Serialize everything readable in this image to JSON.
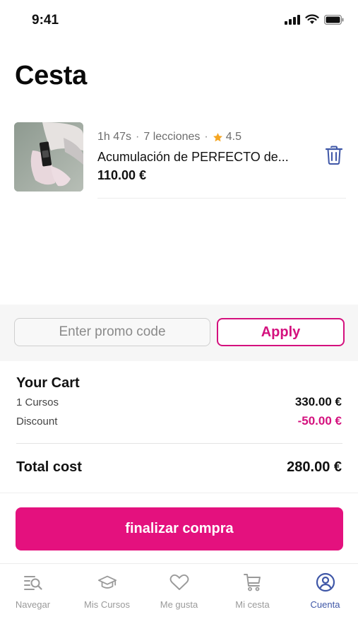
{
  "status": {
    "time": "9:41"
  },
  "page": {
    "title": "Cesta"
  },
  "item": {
    "duration": "1h 47s",
    "lessons": "7 lecciones",
    "rating": "4.5",
    "title": "Acumulación de PERFECTO de...",
    "price": "110.00 €"
  },
  "promo": {
    "placeholder": "Enter promo code",
    "value": "",
    "apply_label": "Apply"
  },
  "summary": {
    "title": "Your Cart",
    "courses_label": "1 Cursos",
    "courses_value": "330.00 €",
    "discount_label": "Discount",
    "discount_value": "-50.00 €",
    "total_label": "Total cost",
    "total_value": "280.00 €"
  },
  "checkout": {
    "label": "finalizar compra"
  },
  "tabs": [
    {
      "label": "Navegar",
      "icon": "browse-icon",
      "active": false
    },
    {
      "label": "Mis Cursos",
      "icon": "graduation-cap-icon",
      "active": false
    },
    {
      "label": "Me gusta",
      "icon": "heart-icon",
      "active": false
    },
    {
      "label": "Mi cesta",
      "icon": "cart-icon",
      "active": false
    },
    {
      "label": "Cuenta",
      "icon": "account-icon",
      "active": true
    }
  ],
  "colors": {
    "accent": "#e4117e",
    "discount": "#d4117e",
    "active_tab": "#3f57a7",
    "inactive_tab": "#9a9a9a",
    "star": "#f5a623"
  }
}
